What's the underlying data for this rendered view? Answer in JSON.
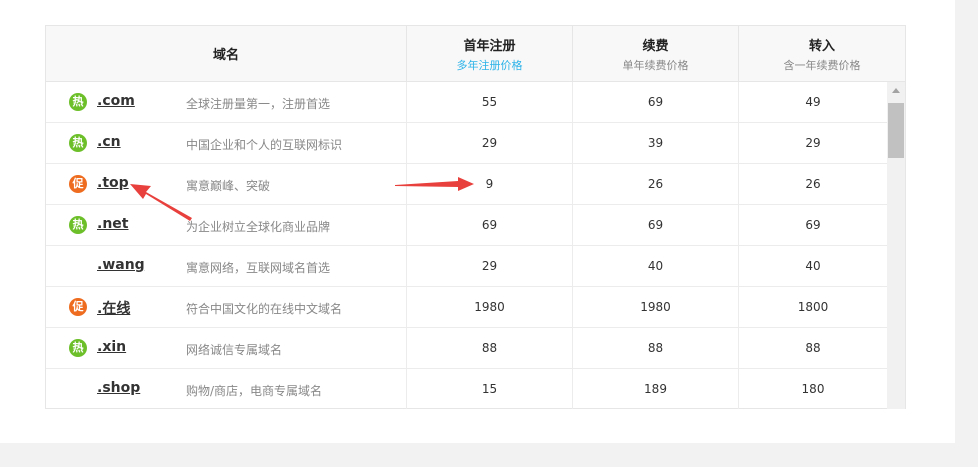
{
  "table": {
    "headers": {
      "domain": "域名",
      "first_year": "首年注册",
      "first_year_sub": "多年注册价格",
      "renew": "续费",
      "renew_sub": "单年续费价格",
      "transfer": "转入",
      "transfer_sub": "含一年续费价格"
    },
    "rows": [
      {
        "badge": "热",
        "badge_type": "hot",
        "domain": ".com",
        "desc": "全球注册量第一，注册首选",
        "first_year": "55",
        "renew": "69",
        "transfer": "49"
      },
      {
        "badge": "热",
        "badge_type": "hot",
        "domain": ".cn",
        "desc": "中国企业和个人的互联网标识",
        "first_year": "29",
        "renew": "39",
        "transfer": "29"
      },
      {
        "badge": "促",
        "badge_type": "promo",
        "domain": ".top",
        "desc": "寓意巅峰、突破",
        "first_year": "9",
        "renew": "26",
        "transfer": "26"
      },
      {
        "badge": "热",
        "badge_type": "hot",
        "domain": ".net",
        "desc": "为企业树立全球化商业品牌",
        "first_year": "69",
        "renew": "69",
        "transfer": "69"
      },
      {
        "badge": "",
        "badge_type": "none",
        "domain": ".wang",
        "desc": "寓意网络，互联网域名首选",
        "first_year": "29",
        "renew": "40",
        "transfer": "40"
      },
      {
        "badge": "促",
        "badge_type": "promo",
        "domain": ".在线",
        "desc": "符合中国文化的在线中文域名",
        "first_year": "1980",
        "renew": "1980",
        "transfer": "1800"
      },
      {
        "badge": "热",
        "badge_type": "hot",
        "domain": ".xin",
        "desc": "网络诚信专属域名",
        "first_year": "88",
        "renew": "88",
        "transfer": "88"
      },
      {
        "badge": "",
        "badge_type": "none",
        "domain": ".shop",
        "desc": "购物/商店，电商专属域名",
        "first_year": "15",
        "renew": "189",
        "transfer": "180"
      }
    ]
  },
  "colors": {
    "hot_badge": "#6dbf2a",
    "promo_badge": "#ee6c1f",
    "annotation_arrow": "#e8403c",
    "accent_sub": "#2eb3e8"
  },
  "icons": {
    "hot": "hot-badge-icon",
    "promo": "promo-badge-icon",
    "scroll_up": "scroll-up-arrow-icon"
  }
}
